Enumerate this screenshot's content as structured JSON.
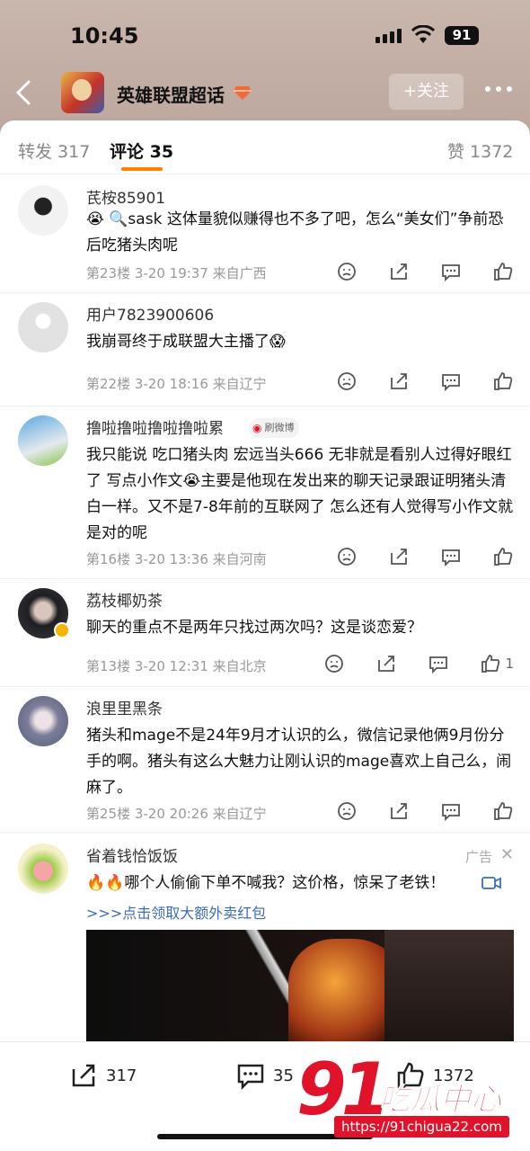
{
  "status_bar": {
    "time": "10:45",
    "battery": "91"
  },
  "nav": {
    "topic_title": "英雄联盟超话",
    "follow_label": "+关注"
  },
  "tabs": {
    "repost": "转发 317",
    "comments": "评论 35",
    "likes": "赞 1372"
  },
  "comments": [
    {
      "user": "芪桉85901",
      "text": "😭 🔍sask 这体量貌似赚得也不多了吧，怎么“美女们”争前恐后吃猪头肉呢",
      "meta": "第23楼 3-20 19:37 来自广西",
      "likes": ""
    },
    {
      "user": "用户7823900606",
      "text": "我崩哥终于成联盟大主播了😱",
      "meta": "第22楼 3-20 18:16 来自辽宁",
      "likes": ""
    },
    {
      "user": "撸啦撸啦撸啦撸啦累",
      "tag": "刷微博",
      "text": "我只能说 吃口猪头肉 宏远当头666 无非就是看别人过得好眼红了 写点小作文😭主要是他现在发出来的聊天记录跟证明猪头清白一样。又不是7-8年前的互联网了 怎么还有人觉得写小作文就是对的呢",
      "meta": "第16楼 3-20 13:36 来自河南",
      "likes": ""
    },
    {
      "user": "荔枝椰奶茶",
      "text": "聊天的重点不是两年只找过两次吗？这是谈恋爱？",
      "meta": "第13楼 3-20 12:31 来自北京",
      "likes": "1"
    },
    {
      "user": "浪里里黑条",
      "text": "猪头和mage不是24年9月才认识的么，微信记录他俩9月份分手的啊。猪头有这么大魅力让刚认识的mage喜欢上自己么，闹麻了。",
      "meta": "第25楼 3-20 20:26 来自辽宁",
      "likes": ""
    }
  ],
  "ad": {
    "user": "省着钱恰饭饭",
    "label": "广告",
    "text": "🔥🔥哪个人偷偷下单不喊我？这价格，惊呆了老铁！",
    "link": ">>>点击领取大额外卖红包"
  },
  "bottom_bar": {
    "repost_count": "317",
    "comment_count": "35",
    "like_count": "1372"
  },
  "watermark": {
    "big": "91",
    "cn": "吃瓜中心",
    "url": "https://91chigua22.com"
  },
  "colors": {
    "accent": "#ff8200",
    "link": "#3b6db5",
    "watermark": "#e0132b"
  }
}
